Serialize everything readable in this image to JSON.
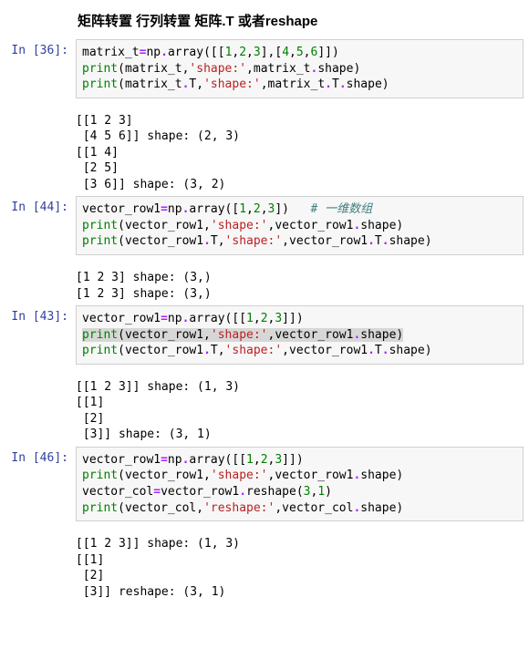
{
  "heading": "矩阵转置 行列转置 矩阵.T 或者reshape",
  "cells": [
    {
      "prompt": "In [36]:",
      "code_tokens": [
        [
          "plain",
          "matrix_t"
        ],
        [
          "op",
          "="
        ],
        [
          "plain",
          "np"
        ],
        [
          "op",
          "."
        ],
        [
          "plain",
          "array([["
        ],
        [
          "num",
          "1"
        ],
        [
          "plain",
          ","
        ],
        [
          "num",
          "2"
        ],
        [
          "plain",
          ","
        ],
        [
          "num",
          "3"
        ],
        [
          "plain",
          "],["
        ],
        [
          "num",
          "4"
        ],
        [
          "plain",
          ","
        ],
        [
          "num",
          "5"
        ],
        [
          "plain",
          ","
        ],
        [
          "num",
          "6"
        ],
        [
          "plain",
          "]])"
        ],
        [
          "nl",
          ""
        ],
        [
          "builtin",
          "print"
        ],
        [
          "plain",
          "(matrix_t,"
        ],
        [
          "str",
          "'shape:'"
        ],
        [
          "plain",
          ",matrix_t"
        ],
        [
          "op",
          "."
        ],
        [
          "plain",
          "shape)"
        ],
        [
          "nl",
          ""
        ],
        [
          "builtin",
          "print"
        ],
        [
          "plain",
          "(matrix_t"
        ],
        [
          "op",
          "."
        ],
        [
          "plain",
          "T,"
        ],
        [
          "str",
          "'shape:'"
        ],
        [
          "plain",
          ",matrix_t"
        ],
        [
          "op",
          "."
        ],
        [
          "plain",
          "T"
        ],
        [
          "op",
          "."
        ],
        [
          "plain",
          "shape)"
        ]
      ],
      "output": "[[1 2 3]\n [4 5 6]] shape: (2, 3)\n[[1 4]\n [2 5]\n [3 6]] shape: (3, 2)"
    },
    {
      "prompt": "In [44]:",
      "code_tokens": [
        [
          "plain",
          "vector_row1"
        ],
        [
          "op",
          "="
        ],
        [
          "plain",
          "np"
        ],
        [
          "op",
          "."
        ],
        [
          "plain",
          "array(["
        ],
        [
          "num",
          "1"
        ],
        [
          "plain",
          ","
        ],
        [
          "num",
          "2"
        ],
        [
          "plain",
          ","
        ],
        [
          "num",
          "3"
        ],
        [
          "plain",
          "])   "
        ],
        [
          "comment",
          "# 一维数组"
        ],
        [
          "nl",
          ""
        ],
        [
          "builtin",
          "print"
        ],
        [
          "plain",
          "(vector_row1,"
        ],
        [
          "str",
          "'shape:'"
        ],
        [
          "plain",
          ",vector_row1"
        ],
        [
          "op",
          "."
        ],
        [
          "plain",
          "shape)"
        ],
        [
          "nl",
          ""
        ],
        [
          "builtin",
          "print"
        ],
        [
          "plain",
          "(vector_row1"
        ],
        [
          "op",
          "."
        ],
        [
          "plain",
          "T,"
        ],
        [
          "str",
          "'shape:'"
        ],
        [
          "plain",
          ",vector_row1"
        ],
        [
          "op",
          "."
        ],
        [
          "plain",
          "T"
        ],
        [
          "op",
          "."
        ],
        [
          "plain",
          "shape)"
        ]
      ],
      "output": "[1 2 3] shape: (3,)\n[1 2 3] shape: (3,)"
    },
    {
      "prompt": "In [43]:",
      "code_tokens": [
        [
          "plain",
          "vector_row1"
        ],
        [
          "op",
          "="
        ],
        [
          "plain",
          "np"
        ],
        [
          "op",
          "."
        ],
        [
          "plain",
          "array([["
        ],
        [
          "num",
          "1"
        ],
        [
          "plain",
          ","
        ],
        [
          "num",
          "2"
        ],
        [
          "plain",
          ","
        ],
        [
          "num",
          "3"
        ],
        [
          "plain",
          "]])"
        ],
        [
          "nl",
          ""
        ],
        [
          "hl-start",
          ""
        ],
        [
          "builtin",
          "print"
        ],
        [
          "plain",
          "(vector_row1,"
        ],
        [
          "str",
          "'shape:'"
        ],
        [
          "plain",
          ",vector_row1"
        ],
        [
          "op",
          "."
        ],
        [
          "plain",
          "shape)"
        ],
        [
          "hl-end",
          ""
        ],
        [
          "nl",
          ""
        ],
        [
          "builtin",
          "print"
        ],
        [
          "plain",
          "(vector_row1"
        ],
        [
          "op",
          "."
        ],
        [
          "plain",
          "T,"
        ],
        [
          "str",
          "'shape:'"
        ],
        [
          "plain",
          ",vector_row1"
        ],
        [
          "op",
          "."
        ],
        [
          "plain",
          "T"
        ],
        [
          "op",
          "."
        ],
        [
          "plain",
          "shape)"
        ]
      ],
      "output": "[[1 2 3]] shape: (1, 3)\n[[1]\n [2]\n [3]] shape: (3, 1)"
    },
    {
      "prompt": "In [46]:",
      "code_tokens": [
        [
          "plain",
          "vector_row1"
        ],
        [
          "op",
          "="
        ],
        [
          "plain",
          "np"
        ],
        [
          "op",
          "."
        ],
        [
          "plain",
          "array([["
        ],
        [
          "num",
          "1"
        ],
        [
          "plain",
          ","
        ],
        [
          "num",
          "2"
        ],
        [
          "plain",
          ","
        ],
        [
          "num",
          "3"
        ],
        [
          "plain",
          "]])"
        ],
        [
          "nl",
          ""
        ],
        [
          "builtin",
          "print"
        ],
        [
          "plain",
          "(vector_row1,"
        ],
        [
          "str",
          "'shape:'"
        ],
        [
          "plain",
          ",vector_row1"
        ],
        [
          "op",
          "."
        ],
        [
          "plain",
          "shape)"
        ],
        [
          "nl",
          ""
        ],
        [
          "plain",
          "vector_col"
        ],
        [
          "op",
          "="
        ],
        [
          "plain",
          "vector_row1"
        ],
        [
          "op",
          "."
        ],
        [
          "plain",
          "reshape("
        ],
        [
          "num",
          "3"
        ],
        [
          "plain",
          ","
        ],
        [
          "num",
          "1"
        ],
        [
          "plain",
          ")"
        ],
        [
          "nl",
          ""
        ],
        [
          "builtin",
          "print"
        ],
        [
          "plain",
          "(vector_col,"
        ],
        [
          "str",
          "'reshape:'"
        ],
        [
          "plain",
          ",vector_col"
        ],
        [
          "op",
          "."
        ],
        [
          "plain",
          "shape)"
        ]
      ],
      "output": "[[1 2 3]] shape: (1, 3)\n[[1]\n [2]\n [3]] reshape: (3, 1)"
    }
  ]
}
